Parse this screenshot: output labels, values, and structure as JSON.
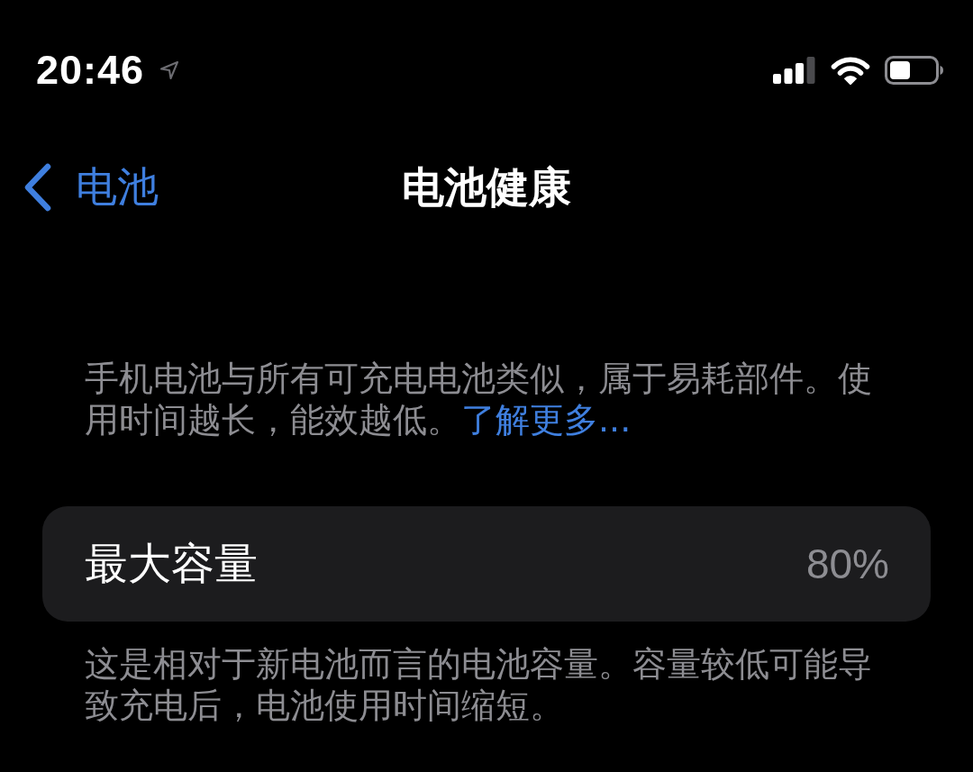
{
  "status_bar": {
    "time": "20:46"
  },
  "nav_bar": {
    "back_label": "电池",
    "title": "电池健康"
  },
  "intro": {
    "text": "手机电池与所有可充电电池类似，属于易耗部件。使用时间越长，能效越低。",
    "link": "了解更多..."
  },
  "capacity": {
    "label": "最大容量",
    "value": "80%"
  },
  "footnote": "这是相对于新电池而言的电池容量。容量较低可能导致充电后，电池使用时间缩短。"
}
